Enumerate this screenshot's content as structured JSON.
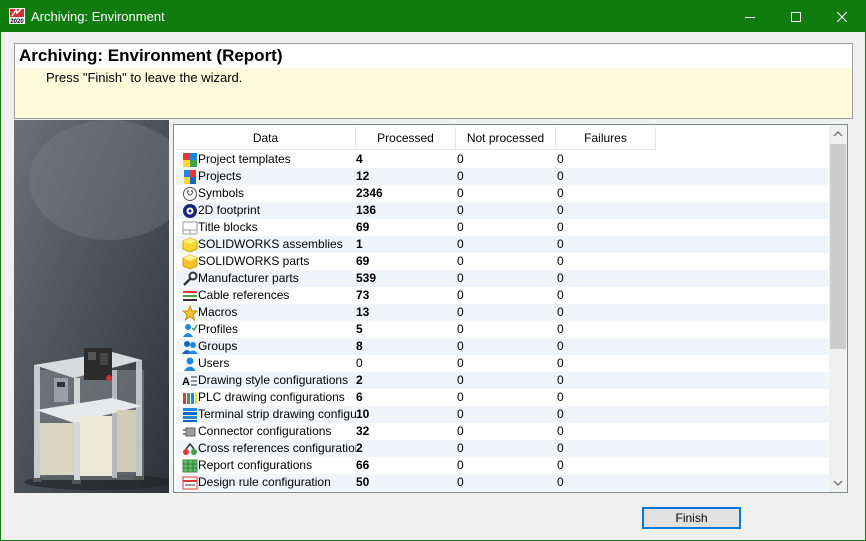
{
  "window": {
    "title": "Archiving: Environment",
    "app_icon_text": "2020",
    "accent": "#107c10"
  },
  "header": {
    "title": "Archiving: Environment (Report)",
    "subtitle": "Press \"Finish\" to leave the wizard.",
    "background": "#fffcdd"
  },
  "table": {
    "columns": [
      "Data",
      "Processed",
      "Not processed",
      "Failures"
    ],
    "rows": [
      {
        "icon": "project-templates-icon",
        "name": "Project templates",
        "processed": "4",
        "not_processed": "0",
        "failures": "0"
      },
      {
        "icon": "projects-icon",
        "name": "Projects",
        "processed": "12",
        "not_processed": "0",
        "failures": "0"
      },
      {
        "icon": "symbols-icon",
        "name": "Symbols",
        "processed": "2346",
        "not_processed": "0",
        "failures": "0"
      },
      {
        "icon": "footprint-icon",
        "name": "2D footprint",
        "processed": "136",
        "not_processed": "0",
        "failures": "0"
      },
      {
        "icon": "title-block-icon",
        "name": "Title blocks",
        "processed": "69",
        "not_processed": "0",
        "failures": "0"
      },
      {
        "icon": "assembly-icon",
        "name": "SOLIDWORKS assemblies",
        "processed": "1",
        "not_processed": "0",
        "failures": "0"
      },
      {
        "icon": "part-icon",
        "name": "SOLIDWORKS parts",
        "processed": "69",
        "not_processed": "0",
        "failures": "0"
      },
      {
        "icon": "wrench-icon",
        "name": "Manufacturer parts",
        "processed": "539",
        "not_processed": "0",
        "failures": "0"
      },
      {
        "icon": "cable-icon",
        "name": "Cable references",
        "processed": "73",
        "not_processed": "0",
        "failures": "0"
      },
      {
        "icon": "star-icon",
        "name": "Macros",
        "processed": "13",
        "not_processed": "0",
        "failures": "0"
      },
      {
        "icon": "profile-icon",
        "name": "Profiles",
        "processed": "5",
        "not_processed": "0",
        "failures": "0"
      },
      {
        "icon": "group-icon",
        "name": "Groups",
        "processed": "8",
        "not_processed": "0",
        "failures": "0"
      },
      {
        "icon": "user-icon",
        "name": "Users",
        "processed": "0",
        "not_processed": "0",
        "failures": "0"
      },
      {
        "icon": "drawing-style-icon",
        "name": "Drawing style configurations",
        "processed": "2",
        "not_processed": "0",
        "failures": "0"
      },
      {
        "icon": "plc-icon",
        "name": "PLC drawing configurations",
        "processed": "6",
        "not_processed": "0",
        "failures": "0"
      },
      {
        "icon": "terminal-strip-icon",
        "name": "Terminal strip drawing configur...",
        "processed": "10",
        "not_processed": "0",
        "failures": "0"
      },
      {
        "icon": "connector-icon",
        "name": "Connector configurations",
        "processed": "32",
        "not_processed": "0",
        "failures": "0"
      },
      {
        "icon": "cross-reference-icon",
        "name": "Cross references configurations",
        "processed": "2",
        "not_processed": "0",
        "failures": "0"
      },
      {
        "icon": "report-icon",
        "name": "Report configurations",
        "processed": "66",
        "not_processed": "0",
        "failures": "0"
      },
      {
        "icon": "design-rule-icon",
        "name": "Design rule configuration",
        "processed": "50",
        "not_processed": "0",
        "failures": "0"
      }
    ]
  },
  "buttons": {
    "finish": "Finish"
  }
}
